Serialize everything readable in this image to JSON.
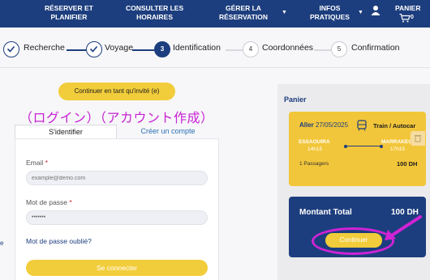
{
  "nav": {
    "items": [
      {
        "line1": "RÉSERVER ET",
        "line2": "PLANIFIER"
      },
      {
        "line1": "CONSULTER LES",
        "line2": "HORAIRES"
      },
      {
        "line1": "GÉRER LA",
        "line2": "RÉSERVATION"
      },
      {
        "line1": "INFOS",
        "line2": "PRATIQUES"
      },
      {
        "line1": "PANIER",
        "line2": ""
      }
    ],
    "cart_count": "0"
  },
  "stepper": {
    "steps": [
      {
        "label": "Recherche",
        "status": "done"
      },
      {
        "label": "Voyage",
        "status": "done"
      },
      {
        "label": "Identification",
        "number": "3",
        "status": "active"
      },
      {
        "label": "Coordonnées",
        "number": "4",
        "status": "todo"
      },
      {
        "label": "Confirmation",
        "number": "5",
        "status": "todo"
      }
    ]
  },
  "guest_button": "Continuer en tant qu'invité (e)",
  "annotation_jp": "（ログイン）（アカウント作成）",
  "tabs": {
    "login": "S'identifier",
    "signup": "Créer un compte"
  },
  "form": {
    "email_label": "Email",
    "email_placeholder": "example@demo.com",
    "password_label": "Mot de passe",
    "password_value": "•••••••",
    "required_mark": "*",
    "forgot_link": "Mot de passe oublié?",
    "submit": "Se connecter"
  },
  "left_edge_text": "e",
  "cart": {
    "title": "Panier",
    "trip": {
      "direction": "Aller",
      "date": "27/05/2025",
      "mode": "Train / Autocar",
      "from": "ESSAOUIRA",
      "from_time": "14h15",
      "to": "MARRAKECH",
      "to_time": "17h15",
      "passengers": "1 Passagers",
      "price": "100 DH"
    },
    "total_label": "Montant Total",
    "total_value": "100 DH",
    "continue": "Continuer"
  },
  "colors": {
    "primary": "#1d3e7e",
    "accent": "#f2cd3b",
    "highlight": "#d023d6"
  }
}
